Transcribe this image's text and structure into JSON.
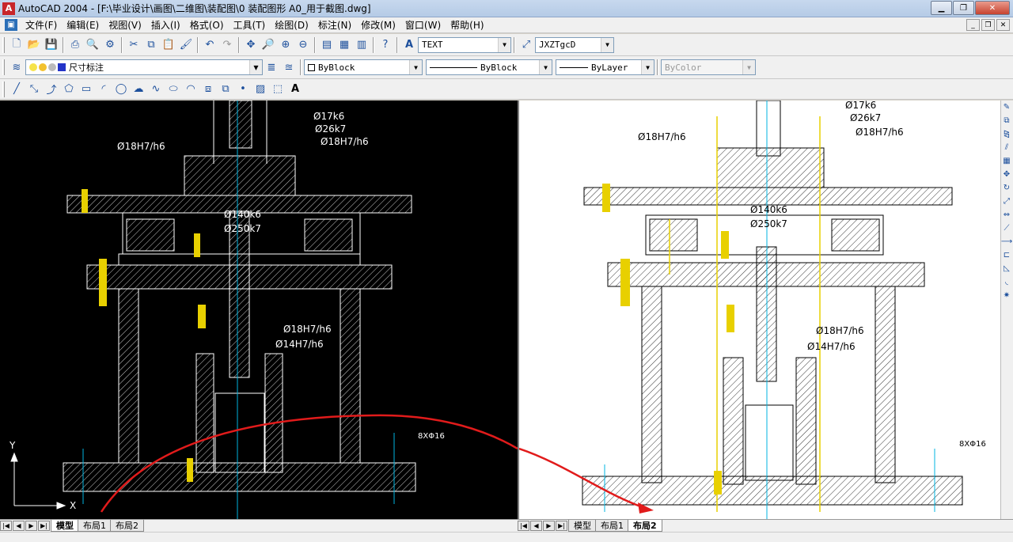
{
  "window": {
    "title": "AutoCAD 2004 - [F:\\毕业设计\\画图\\二维图\\装配图\\0 装配图形 A0_用于截图.dwg]",
    "app_icon": "autocad-logo-icon",
    "controls": [
      "minimize-icon",
      "restore-icon",
      "close-icon"
    ]
  },
  "menu": {
    "items": [
      "文件(F)",
      "编辑(E)",
      "视图(V)",
      "插入(I)",
      "格式(O)",
      "工具(T)",
      "绘图(D)",
      "标注(N)",
      "修改(M)",
      "窗口(W)",
      "帮助(H)"
    ]
  },
  "toolbar_standard": {
    "text_style": "TEXT",
    "dim_style": "JXZTgcD"
  },
  "toolbar_layers": {
    "current_layer": "尺寸标注",
    "color": "ByBlock",
    "linetype": "ByBlock",
    "lineweight": "ByLayer",
    "plot_style": "ByColor"
  },
  "drawing_labels": {
    "d17k6": "Ø17k6",
    "d26k7": "Ø26k7",
    "d18h7h6": "Ø18H7/h6",
    "d140k6": "Ø140k6",
    "d250k7": "Ø250k7",
    "d14h7h6": "Ø14H7/h6",
    "holes_left": "8XΦ16",
    "holes_right": "8XΦ16",
    "axis_y": "Y",
    "axis_x": "X"
  },
  "tabs_left": {
    "items": [
      "模型",
      "布局1",
      "布局2"
    ],
    "active": "模型"
  },
  "tabs_right": {
    "items": [
      "模型",
      "布局1",
      "布局2"
    ],
    "active": "布局2"
  },
  "colors": {
    "model_bg": "#000000",
    "paper_bg": "#ffffff",
    "annotation_stroke": "#e11b1b",
    "centerline": "#00b5e0",
    "bolt": "#e8d000"
  }
}
